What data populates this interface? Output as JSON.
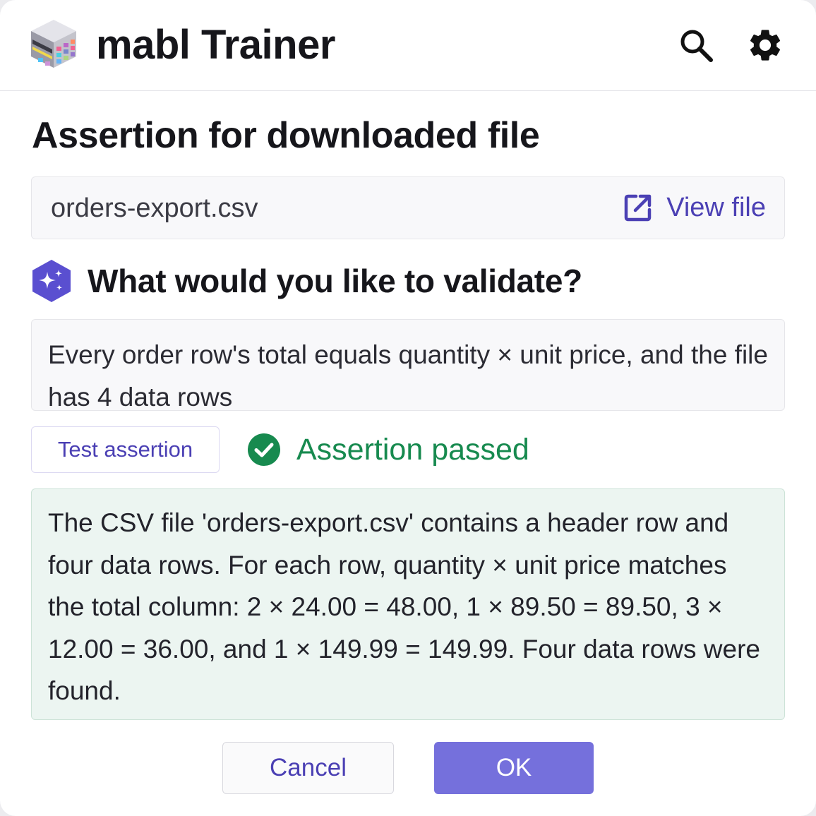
{
  "header": {
    "title": "mabl Trainer",
    "logo_icon": "mabl-cube-logo",
    "search_icon": "search-icon",
    "settings_icon": "gear-icon"
  },
  "assertion": {
    "title": "Assertion for downloaded file",
    "file_name": "orders-export.csv",
    "view_file_label": "View file",
    "view_file_icon": "external-link-icon"
  },
  "prompt": {
    "question": "What would you like to validate?",
    "icon": "ai-sparkle-icon",
    "value": "Every order row's total equals quantity × unit price, and the file has 4 data rows"
  },
  "test": {
    "button_label": "Test assertion",
    "status_text": "Assertion passed",
    "status_icon": "check-circle-icon",
    "status_color": "#178a4f"
  },
  "result": {
    "text": "The CSV file 'orders-export.csv' contains a header row and four data rows. For each row, quantity × unit price matches the total column: 2 × 24.00 = 48.00, 1 × 89.50 = 89.50, 3 × 12.00 = 36.00, and 1 × 149.99 = 149.99. Four data rows were found."
  },
  "footer": {
    "cancel_label": "Cancel",
    "ok_label": "OK"
  },
  "colors": {
    "accent": "#4b40b4",
    "primary_button": "#7570dc",
    "success": "#178a4f",
    "result_background": "#ecf5f1"
  }
}
